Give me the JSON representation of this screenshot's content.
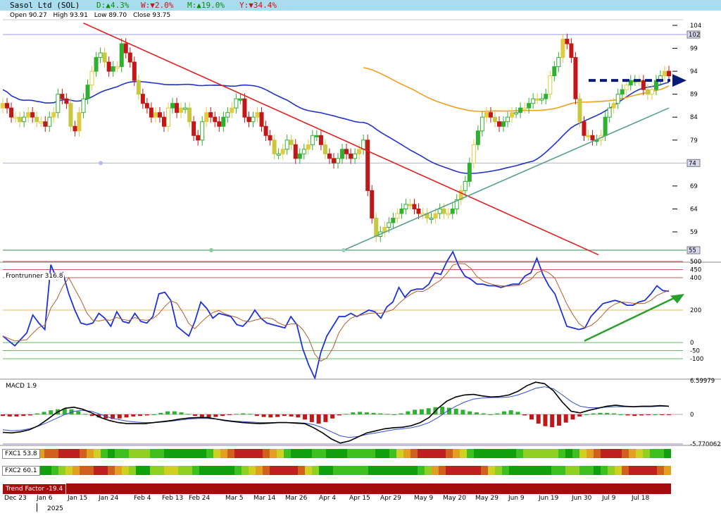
{
  "title": {
    "name": "Sasol Ltd (SOL)",
    "day": "D:▲4.3%",
    "week": "W:▼2.0%",
    "month": "M:▲19.0%",
    "year": "Y:▼34.4%",
    "colors": {
      "bg": "#a9dced",
      "up": "#0a8f0a",
      "down": "#d01010"
    }
  },
  "ohlc": {
    "open": "Open 90.27",
    "high": "High 93.91",
    "low": "Low 89.70",
    "close": "Close 93.75"
  },
  "panel_labels": {
    "frontrunner": "Frontrunner 316.8",
    "macd": "MACD 1.9",
    "fxc1": "FXC1 53.8",
    "fxc2": "FXC2 60.1",
    "trend": "Trend Factor -19.4"
  },
  "x_axis": {
    "labels": [
      "Dec 23",
      "Jan 6",
      "Jan 15",
      "Jan 24",
      "Feb 4",
      "Feb 13",
      "Feb 24",
      "Mar 5",
      "Mar 14",
      "Mar 26",
      "Apr 4",
      "Apr 15",
      "Apr 29",
      "May 9",
      "May 20",
      "May 29",
      "Jun 9",
      "Jun 19",
      "Jun 30",
      "Jul 9",
      "Jul 18"
    ],
    "year": "2025"
  },
  "chart_data": [
    {
      "type": "candlestick",
      "y_ticks": [
        104,
        99,
        94,
        89,
        84,
        79,
        69,
        64,
        59
      ],
      "level_labels": [
        "102",
        "74",
        "55"
      ],
      "ylim": [
        54,
        106
      ],
      "x_range": [
        0,
        157
      ],
      "closes": [
        87,
        86,
        84,
        84,
        83,
        84,
        85,
        84,
        83,
        83,
        82,
        84,
        85,
        89,
        88,
        87,
        82,
        81,
        85,
        88,
        91,
        94,
        97,
        98,
        96,
        94,
        95,
        95,
        100,
        98,
        96,
        92,
        89,
        87,
        86,
        84,
        85,
        84,
        82,
        86,
        87,
        85,
        86,
        86,
        83,
        80,
        79,
        83,
        85,
        84,
        83,
        82,
        84,
        85,
        86,
        88,
        88,
        84,
        83,
        84,
        85,
        82,
        80,
        79,
        76,
        76,
        77,
        79,
        78,
        75,
        76,
        77,
        78,
        80,
        80,
        78,
        76,
        75,
        74,
        75,
        77,
        76,
        75,
        76,
        77,
        79,
        68,
        62,
        58,
        59,
        60,
        61,
        62,
        63,
        64,
        65,
        65,
        64,
        63,
        63,
        62,
        62,
        63,
        64,
        63,
        63,
        64,
        66,
        68,
        70,
        74,
        78,
        81,
        84,
        85,
        84,
        83,
        82,
        83,
        84,
        85,
        85,
        86,
        86,
        87,
        88,
        88,
        88,
        89,
        93,
        95,
        97,
        101,
        100,
        97,
        88,
        83,
        80,
        80,
        79,
        79,
        80,
        84,
        86,
        87,
        89,
        90,
        91,
        92,
        92,
        92,
        90,
        89,
        90,
        92,
        93,
        94,
        93
      ],
      "annotations": [
        "descending resistance line (red)",
        "ascending support line (teal)",
        "dashed arrow at ~92",
        "horizontal levels 102 / 74 / 55"
      ]
    },
    {
      "type": "line",
      "name": "Frontrunner",
      "y_ticks": [
        500,
        450,
        400,
        200,
        0,
        -50,
        -100
      ],
      "ylim": [
        -210,
        560
      ],
      "values": [
        40,
        10,
        -20,
        20,
        60,
        170,
        120,
        80,
        480,
        390,
        430,
        300,
        200,
        120,
        110,
        120,
        180,
        150,
        100,
        190,
        130,
        120,
        180,
        130,
        120,
        160,
        300,
        310,
        260,
        100,
        70,
        40,
        130,
        250,
        210,
        150,
        180,
        170,
        160,
        110,
        100,
        140,
        200,
        150,
        120,
        110,
        100,
        90,
        160,
        110,
        -40,
        -140,
        -220,
        -60,
        40,
        100,
        160,
        160,
        180,
        160,
        180,
        200,
        190,
        150,
        220,
        250,
        340,
        280,
        320,
        330,
        330,
        360,
        430,
        420,
        500,
        560,
        470,
        410,
        390,
        360,
        360,
        350,
        350,
        340,
        350,
        360,
        360,
        410,
        430,
        520,
        420,
        350,
        300,
        200,
        100,
        90,
        80,
        90,
        160,
        200,
        240,
        250,
        260,
        250,
        230,
        230,
        250,
        260,
        300,
        350,
        320,
        316
      ]
    },
    {
      "type": "bar",
      "name": "MACD",
      "y_ticks": [
        6.59979,
        0,
        -5.770062
      ],
      "ylim": [
        -5.770062,
        6.59979
      ],
      "histogram": [
        -0.3,
        -0.4,
        -0.4,
        -0.3,
        -0.2,
        0.2,
        0.5,
        0.8,
        1.0,
        1.1,
        1.0,
        0.6,
        0.1,
        -0.3,
        -0.6,
        -0.8,
        -0.9,
        -0.8,
        -0.6,
        -0.4,
        -0.3,
        -0.2,
        0.0,
        0.3,
        0.6,
        0.6,
        0.4,
        0.1,
        -0.3,
        -0.5,
        -0.6,
        -0.5,
        -0.3,
        -0.1,
        0.1,
        0.2,
        0.1,
        -0.3,
        -0.5,
        -0.6,
        -0.5,
        -0.3,
        -0.4,
        -0.6,
        -1.0,
        -1.5,
        -1.8,
        -1.5,
        -0.8,
        -0.2,
        0.1,
        0.4,
        0.5,
        0.4,
        0.3,
        0.2,
        0.1,
        0.0,
        0.2,
        0.6,
        0.9,
        1.0,
        1.2,
        1.4,
        1.5,
        1.3,
        1.1,
        0.9,
        0.6,
        0.4,
        0.2,
        0.0,
        0.2,
        0.6,
        0.8,
        0.5,
        -0.2,
        -1.0,
        -1.8,
        -2.3,
        -2.5,
        -2.2,
        -1.6,
        -1.0,
        -0.4,
        0.0,
        0.2,
        0.3,
        0.3,
        0.2,
        0.0,
        -0.2,
        -0.3,
        -0.2,
        -0.1,
        0.0,
        -0.1,
        -0.1
      ],
      "macd_line": [
        -3.5,
        -3.6,
        -3.4,
        -3.0,
        -2.2,
        -1.0,
        0.3,
        1.2,
        1.4,
        1.0,
        0.3,
        -0.6,
        -1.2,
        -1.6,
        -1.8,
        -1.8,
        -1.8,
        -1.6,
        -1.4,
        -1.2,
        -0.9,
        -0.7,
        -0.6,
        -0.6,
        -0.9,
        -1.2,
        -1.4,
        -1.6,
        -1.7,
        -1.8,
        -1.7,
        -1.6,
        -1.6,
        -1.7,
        -1.8,
        -2.6,
        -3.6,
        -4.8,
        -5.6,
        -5.2,
        -4.4,
        -3.6,
        -3.2,
        -2.8,
        -2.6,
        -2.5,
        -2.2,
        -1.6,
        -0.6,
        1.2,
        2.6,
        3.4,
        3.8,
        3.9,
        3.6,
        3.4,
        3.5,
        3.8,
        4.5,
        5.6,
        6.3,
        6.0,
        4.6,
        2.4,
        0.6,
        0.3,
        0.8,
        1.2,
        1.6,
        1.8,
        1.6,
        1.5,
        1.6,
        1.6,
        1.7,
        1.6
      ],
      "signal_line": [
        -3.0,
        -3.2,
        -3.1,
        -2.8,
        -2.3,
        -1.6,
        -0.8,
        0.0,
        0.6,
        0.8,
        0.6,
        0.0,
        -0.6,
        -1.0,
        -1.3,
        -1.5,
        -1.6,
        -1.6,
        -1.5,
        -1.3,
        -1.1,
        -0.9,
        -0.8,
        -0.8,
        -0.9,
        -1.1,
        -1.3,
        -1.4,
        -1.5,
        -1.6,
        -1.6,
        -1.6,
        -1.6,
        -1.6,
        -1.7,
        -2.0,
        -2.6,
        -3.4,
        -4.2,
        -4.5,
        -4.3,
        -3.9,
        -3.6,
        -3.3,
        -3.0,
        -2.8,
        -2.6,
        -2.2,
        -1.6,
        -0.6,
        0.6,
        1.6,
        2.4,
        3.0,
        3.2,
        3.3,
        3.3,
        3.4,
        3.8,
        4.4,
        5.1,
        5.4,
        5.0,
        3.8,
        2.5,
        1.6,
        1.3,
        1.3,
        1.4,
        1.5,
        1.5,
        1.5,
        1.5,
        1.5,
        1.6,
        1.6
      ]
    }
  ]
}
